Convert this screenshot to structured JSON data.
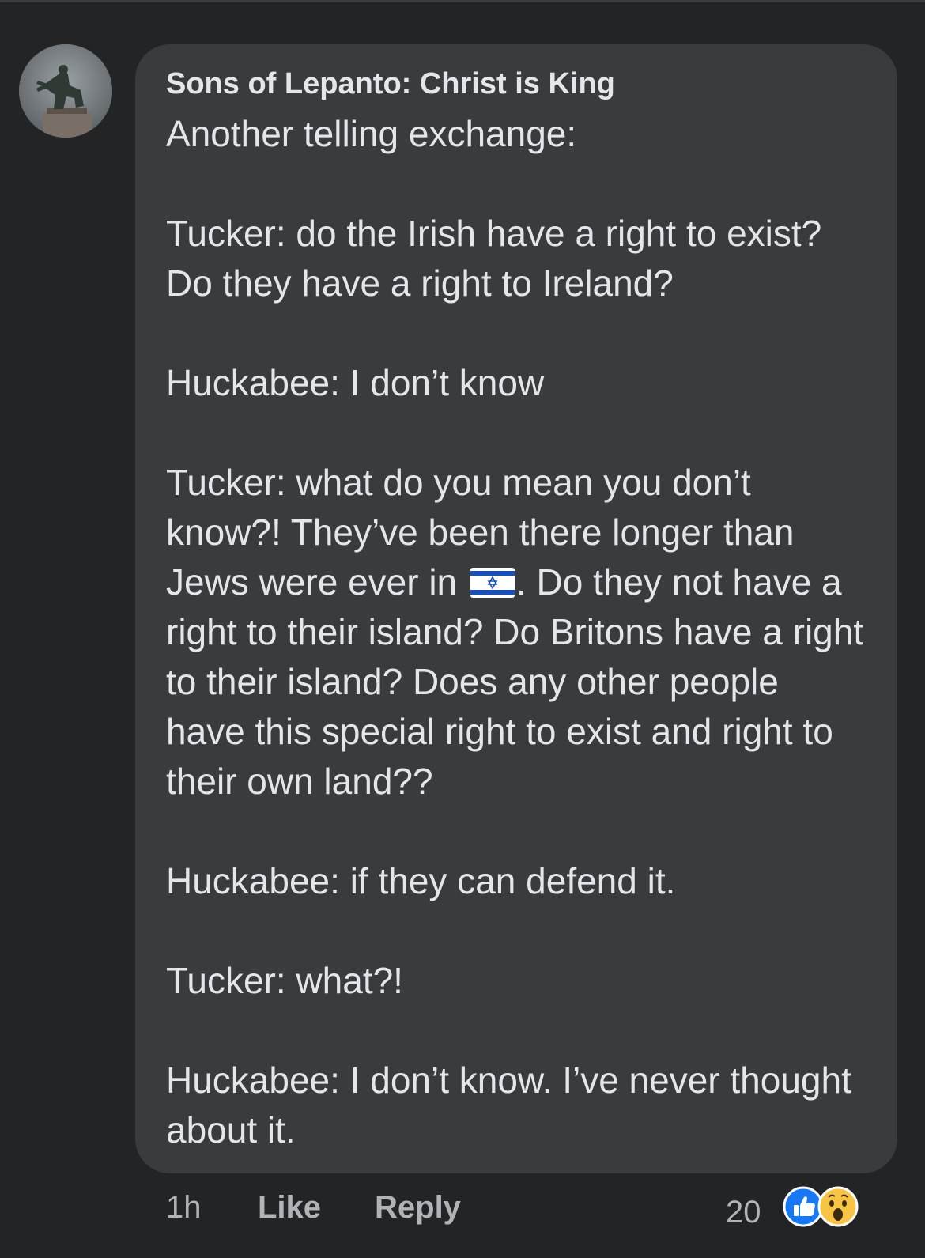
{
  "comment": {
    "author": "Sons of Lepanto: Christ is King",
    "paragraphs": [
      "Another telling exchange:",
      "Tucker: do the Irish have a right to exist? Do they have a right to Ireland?",
      "Huckabee: I don’t know",
      {
        "before_flag": "Tucker: what do you mean you don’t know?! They’ve been there longer than Jews were ever in ",
        "after_flag": ". Do they not have a right to their island? Do Britons have a right to their island? Does any other people have this special right to exist and right to their own land??"
      },
      "Huckabee: if they can defend it.",
      "Tucker: what?!",
      "Huckabee: I don’t know. I’ve never thought about it."
    ],
    "flag_icon": "israel-flag-emoji"
  },
  "footer": {
    "time": "1h",
    "like_label": "Like",
    "reply_label": "Reply",
    "reaction_count": "20",
    "reactions": [
      "like-reaction-icon",
      "wow-reaction-icon"
    ]
  },
  "colors": {
    "background": "#232426",
    "bubble": "#3a3b3c",
    "text": "#e4e6eb",
    "secondary_text": "#b0b3b8",
    "like_blue": "#1877f2",
    "wow_yellow": "#f7c443"
  }
}
